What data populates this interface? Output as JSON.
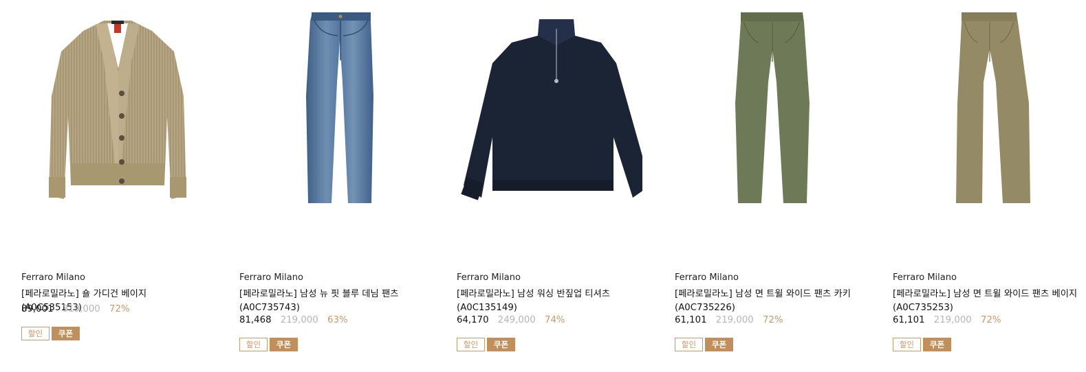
{
  "products": [
    {
      "icon": "cardigan-image",
      "brand": "Ferraro Milano",
      "name": "[페라로밀라노] 숄 가디건 베이지 (A0C535153)",
      "price": "89,001",
      "original_price": "319,000",
      "discount_rate": "72%",
      "badges": {
        "sale": "할인",
        "coupon": "쿠폰"
      }
    },
    {
      "icon": "jeans-image",
      "brand": "Ferraro Milano",
      "name": "[페라로밀라노] 남성 뉴 핏 블루 데님 팬츠 (A0C735743)",
      "price": "81,468",
      "original_price": "219,000",
      "discount_rate": "63%",
      "badges": {
        "sale": "할인",
        "coupon": "쿠폰"
      }
    },
    {
      "icon": "halfzip-sweatshirt-image",
      "brand": "Ferraro Milano",
      "name": "[페라로밀라노] 남성 워싱 반짚업 티셔츠 (A0C135149)",
      "price": "64,170",
      "original_price": "249,000",
      "discount_rate": "74%",
      "badges": {
        "sale": "할인",
        "coupon": "쿠폰"
      }
    },
    {
      "icon": "khaki-pants-image",
      "brand": "Ferraro Milano",
      "name": "[페라로밀라노] 남성 면 트윌 와이드 팬츠 카키 (A0C735226)",
      "price": "61,101",
      "original_price": "219,000",
      "discount_rate": "72%",
      "badges": {
        "sale": "할인",
        "coupon": "쿠폰"
      }
    },
    {
      "icon": "beige-pants-image",
      "brand": "Ferraro Milano",
      "name": "[페라로밀라노] 남성 면 트윌 와이드 팬츠 베이지 (A0C735253)",
      "price": "61,101",
      "original_price": "219,000",
      "discount_rate": "72%",
      "badges": {
        "sale": "할인",
        "coupon": "쿠폰"
      }
    }
  ],
  "colors": {
    "discount": "#c39a6b",
    "original_price": "#b5b5b5",
    "coupon_bg": "#c18f5b",
    "sale_border": "#c59a6c"
  }
}
